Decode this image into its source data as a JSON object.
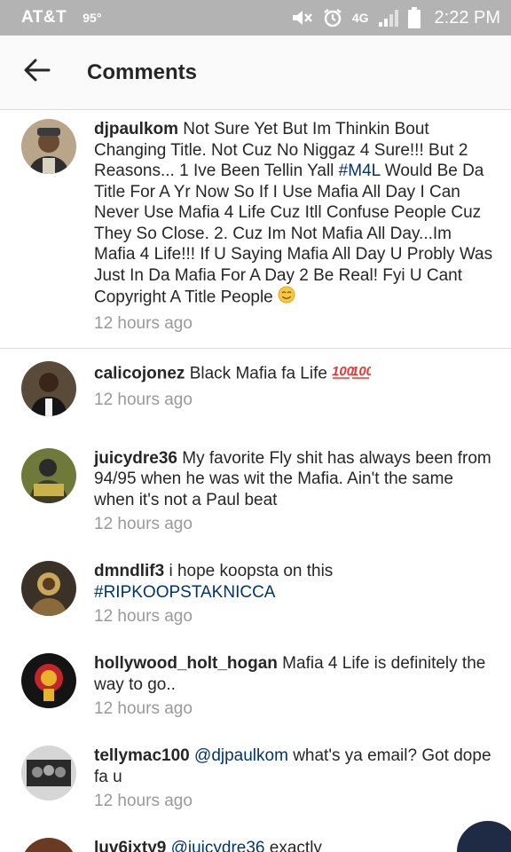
{
  "status_bar": {
    "carrier": "AT&T",
    "temperature": "95°",
    "network": "4G",
    "time": "2:22 PM"
  },
  "header": {
    "title": "Comments",
    "back_icon": "arrow-left-icon"
  },
  "comments": [
    {
      "username": "djpaulkom",
      "parts": [
        {
          "text": " Not Sure Yet But Im Thinkin Bout Changing Title. Not Cuz No Niggaz 4 Sure!!! But 2 Reasons... 1 Ive Been Tellin Yall "
        },
        {
          "link": "#M4L"
        },
        {
          "text": " Would Be Da Title For A Yr Now So If I Use Mafia All Day I Can Never Use Mafia 4 Life Cuz Itll Confuse People Cuz They So Close. 2. Cuz Im Not Mafia All Day...Im Mafia 4 Life!!! If U Saying Mafia All Day U Probly Was Just In Da Mafia For A Day 2 Be Real! Fyi U Cant Copyright A Title People "
        }
      ],
      "emoji": "smiling-face-emoji",
      "time": "12 hours ago"
    },
    {
      "username": "calicojonez",
      "parts": [
        {
          "text": " Black Mafia fa Life "
        }
      ],
      "emoji": "hundred-points-emoji-x2",
      "time": "12 hours ago"
    },
    {
      "username": "juicydre36",
      "parts": [
        {
          "text": " My favorite Fly shit has always been from 94/95 when he was wit the Mafia. Ain't the same when it's not a Paul beat"
        }
      ],
      "time": "12 hours ago"
    },
    {
      "username": "dmndlif3",
      "parts": [
        {
          "text": " i hope koopsta on this "
        },
        {
          "link": "#RIPKOOPSTAKNICCA"
        }
      ],
      "time": "12 hours ago"
    },
    {
      "username": "hollywood_holt_hogan",
      "parts": [
        {
          "text": " Mafia 4 Life is definitely the way to go.."
        }
      ],
      "time": "12 hours ago"
    },
    {
      "username": "tellymac100",
      "parts": [
        {
          "link": " @djpaulkom"
        },
        {
          "text": " what's ya email? Got dope fa u"
        }
      ],
      "time": "12 hours ago"
    },
    {
      "username": "luv6ixty9",
      "parts": [
        {
          "link": " @juicydre36"
        },
        {
          "text": " exactly"
        }
      ],
      "time": ""
    }
  ],
  "colors": {
    "status_bar_bg": "#b3b3b3",
    "link": "#003569",
    "timestamp": "#999999",
    "divider": "#dbdbdb"
  }
}
